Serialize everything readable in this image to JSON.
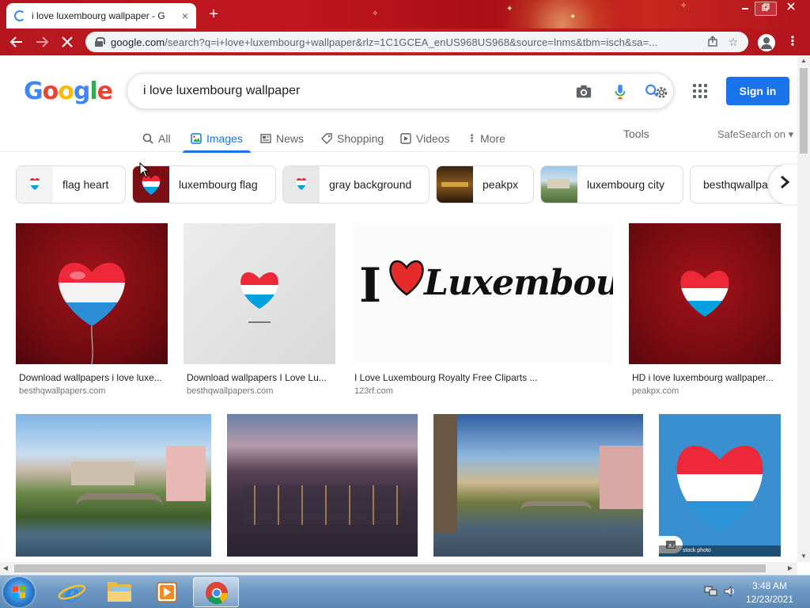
{
  "browser": {
    "tab_title": "i love luxembourg wallpaper - G",
    "tab_close": "×",
    "new_tab": "+",
    "url_host": "google.com",
    "url_rest": "/search?q=i+love+luxembourg+wallpaper&rlz=1C1GCEA_enUS968US968&source=lnms&tbm=isch&sa=..."
  },
  "google": {
    "logo_letters": [
      "G",
      "o",
      "o",
      "g",
      "l",
      "e"
    ],
    "query": "i love luxembourg wallpaper",
    "sign_in": "Sign in",
    "tabs": [
      {
        "label": "All",
        "icon": "search-icon"
      },
      {
        "label": "Images",
        "icon": "image-icon"
      },
      {
        "label": "News",
        "icon": "news-icon"
      },
      {
        "label": "Shopping",
        "icon": "tag-icon"
      },
      {
        "label": "Videos",
        "icon": "video-icon"
      },
      {
        "label": "More",
        "icon": "more-icon"
      }
    ],
    "tools": "Tools",
    "safesearch": "SafeSearch on ▾",
    "chips": [
      "flag heart",
      "luxembourg flag",
      "gray background",
      "peakpx",
      "luxembourg city",
      "besthqwallpa"
    ],
    "results_row1": [
      {
        "caption": "Download wallpapers i love luxe...",
        "source": "besthqwallpapers.com"
      },
      {
        "caption": "Download wallpapers I Love Lu...",
        "source": "besthqwallpapers.com"
      },
      {
        "caption": "I Love Luxembourg Royalty Free Cliparts ...",
        "source": "123rf.com",
        "art_text": "Luxembourg",
        "art_i": "I"
      },
      {
        "caption": "HD i love luxembourg wallpaper...",
        "source": "peakpx.com"
      }
    ],
    "stock_label": "stock photo"
  },
  "taskbar": {
    "time": "3:48 AM",
    "date": "12/23/2021"
  },
  "colors": {
    "flag_red": "#ed2939",
    "flag_white": "#ffffff",
    "flag_blue": "#00a1de",
    "google_blue": "#1a73e8",
    "chrome_red": "#b6171f"
  }
}
